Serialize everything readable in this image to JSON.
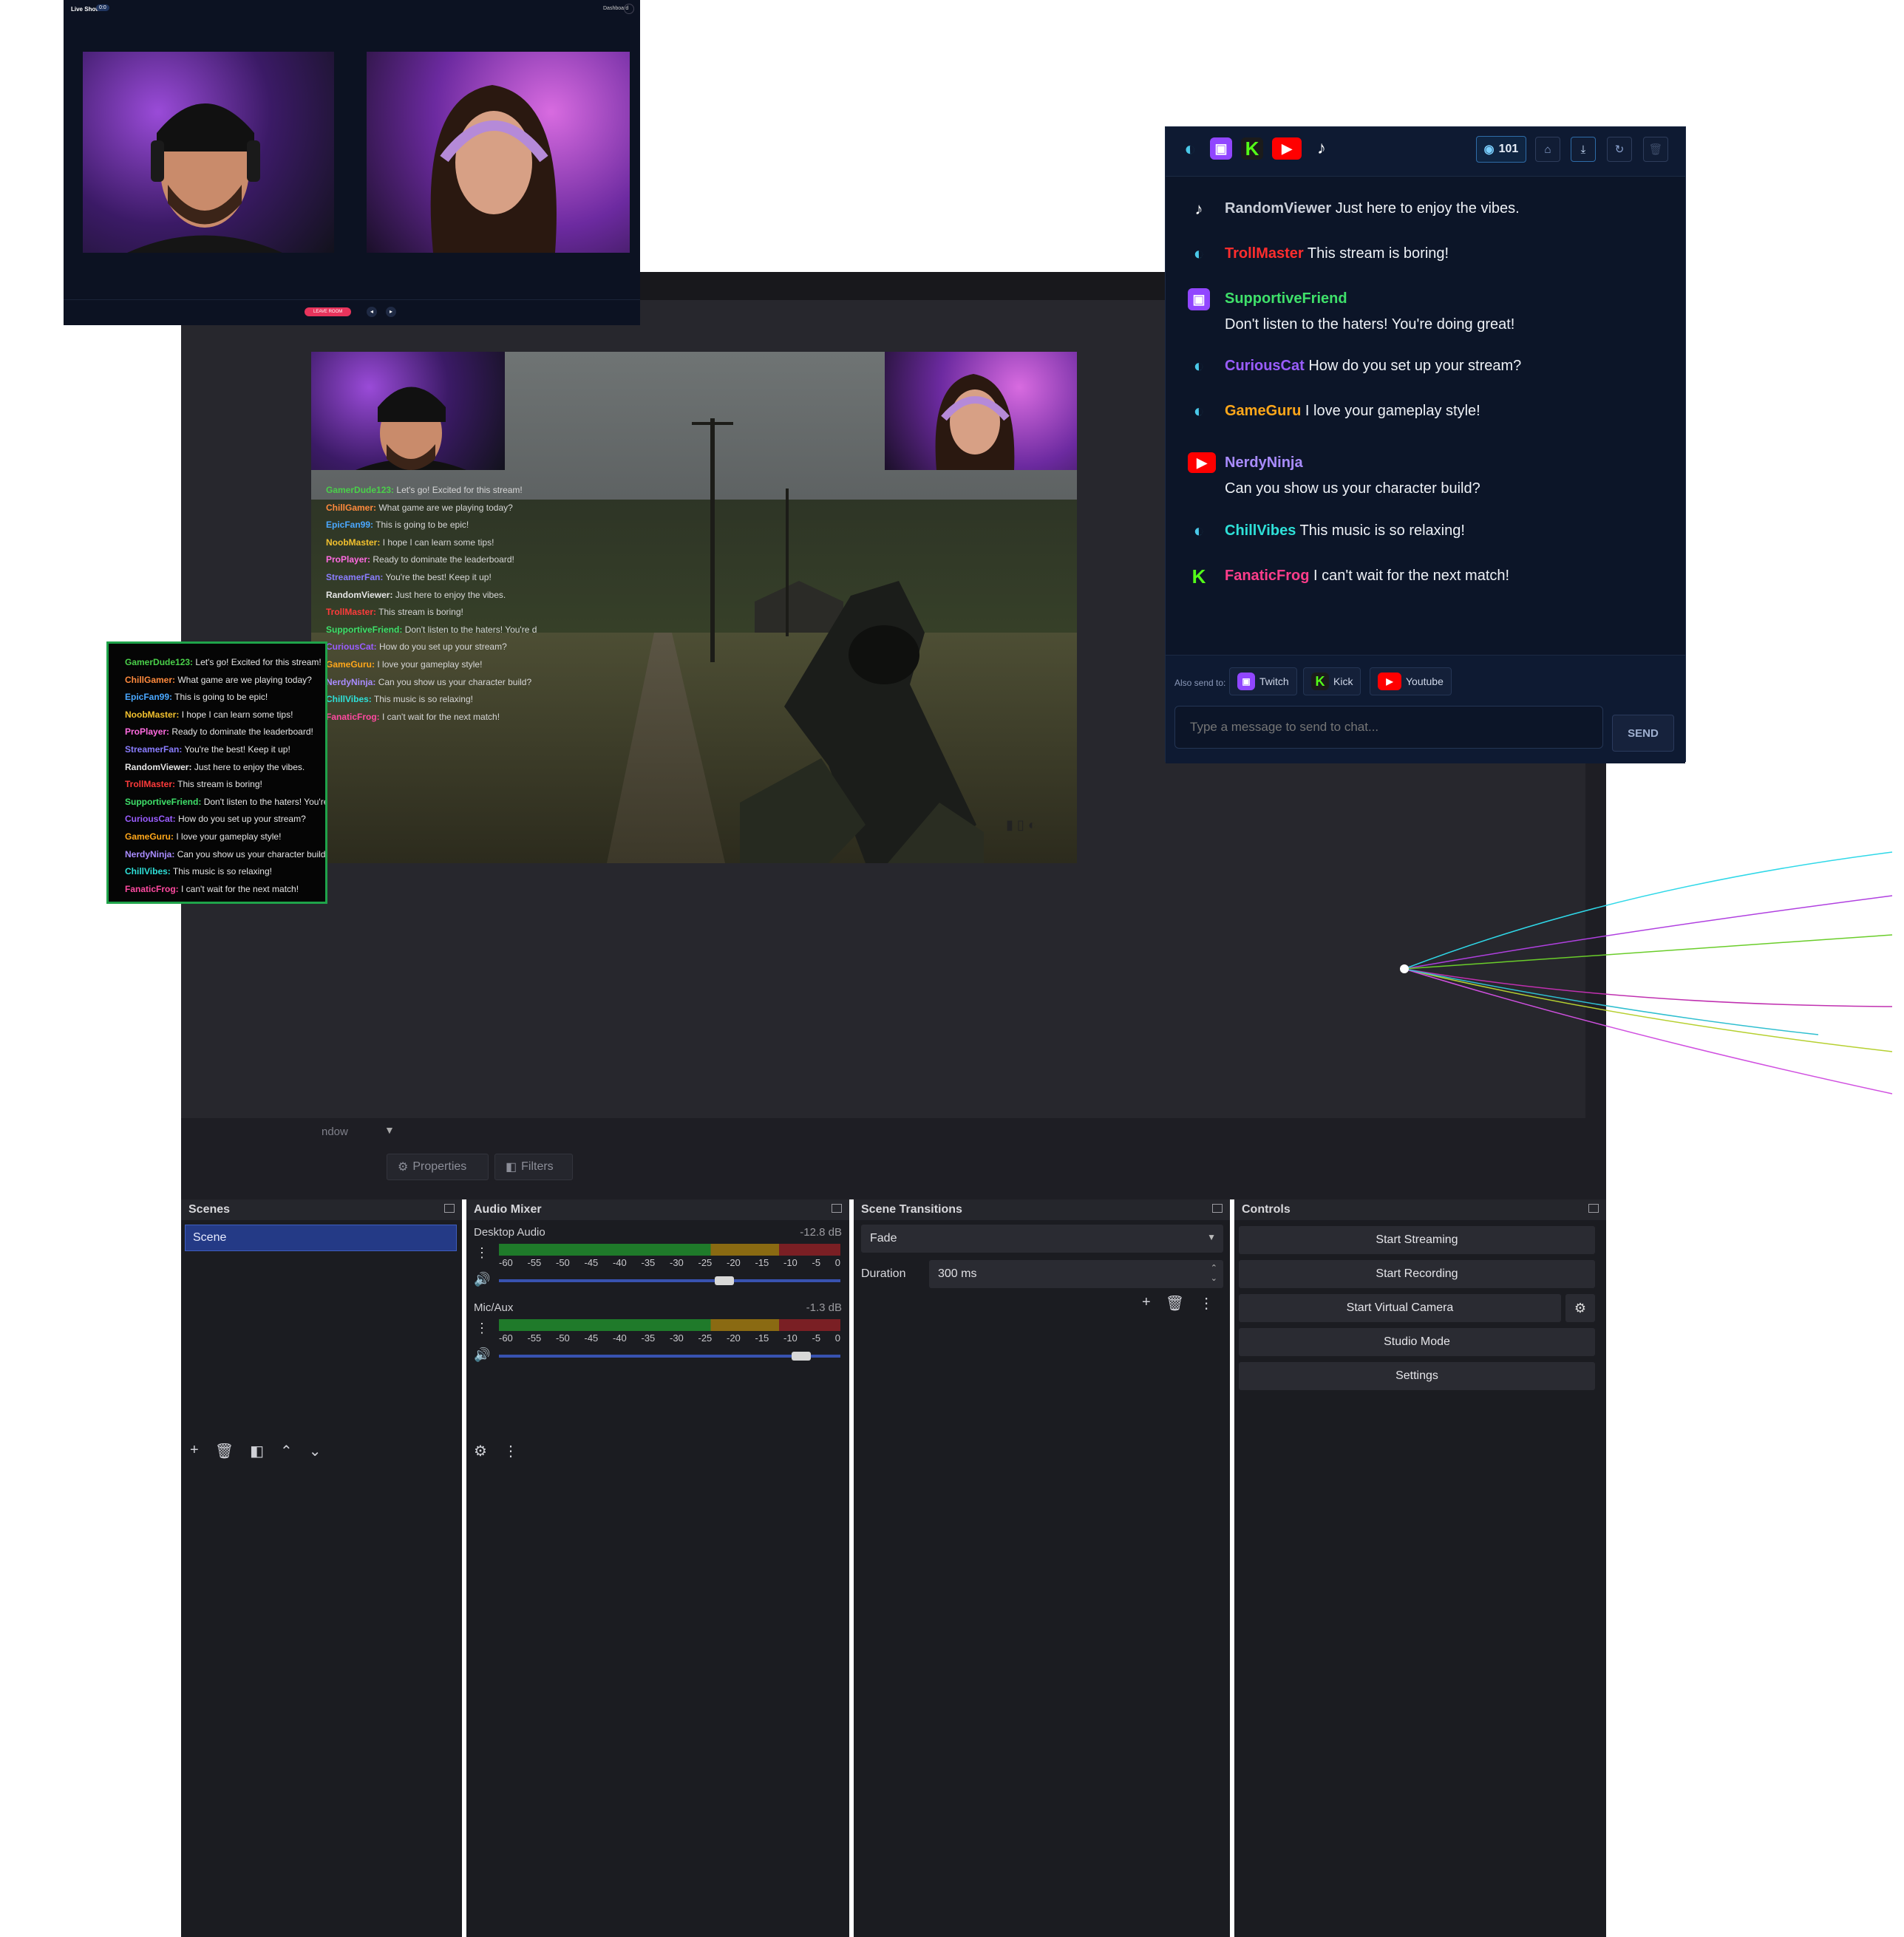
{
  "liveshow": {
    "title": "Live Show",
    "badge": "0:0",
    "right_label": "Dashboard",
    "leave_button": "LEAVE ROOM"
  },
  "obs": {
    "scene_dropdown_label": "ndow",
    "properties_label": "Properties",
    "filters_label": "Filters",
    "scenes": {
      "title": "Scenes",
      "items": [
        "Scene"
      ]
    },
    "audio_mixer": {
      "title": "Audio Mixer",
      "channels": [
        {
          "name": "Desktop Audio",
          "db": "-12.8 dB",
          "level": 0.68
        },
        {
          "name": "Mic/Aux",
          "db": "-1.3 dB",
          "level": 0.92
        }
      ],
      "scale": [
        "-60",
        "-55",
        "-50",
        "-45",
        "-40",
        "-35",
        "-30",
        "-25",
        "-20",
        "-15",
        "-10",
        "-5",
        "0"
      ]
    },
    "transitions": {
      "title": "Scene Transitions",
      "type": "Fade",
      "duration_label": "Duration",
      "duration_value": "300 ms"
    },
    "controls": {
      "title": "Controls",
      "buttons": [
        "Start Streaming",
        "Start Recording",
        "Start Virtual Camera",
        "Studio Mode",
        "Settings"
      ]
    }
  },
  "overlay_chat": [
    {
      "user": "GamerDude123:",
      "text": "Let's go! Excited for this stream!",
      "color": "#4ad04a"
    },
    {
      "user": "ChillGamer:",
      "text": "What game are we playing today?",
      "color": "#ff8a3d"
    },
    {
      "user": "EpicFan99:",
      "text": "This is going to be epic!",
      "color": "#4aa8ff"
    },
    {
      "user": "NoobMaster:",
      "text": "I hope I can learn some tips!",
      "color": "#f2c12e"
    },
    {
      "user": "ProPlayer:",
      "text": "Ready to dominate the leaderboard!",
      "color": "#ff6be0"
    },
    {
      "user": "StreamerFan:",
      "text": "You're the best! Keep it up!",
      "color": "#8a7dff"
    },
    {
      "user": "RandomViewer:",
      "text": "Just here to enjoy the vibes.",
      "color": "#e6e6e6"
    },
    {
      "user": "TrollMaster:",
      "text": "This stream is boring!",
      "color": "#ff3b3b"
    },
    {
      "user": "SupportiveFriend:",
      "text": "Don't listen to the haters! You're d",
      "color": "#3fe06a"
    },
    {
      "user": "CuriousCat:",
      "text": "How do you set up your stream?",
      "color": "#9a5dff"
    },
    {
      "user": "GameGuru:",
      "text": "I love your gameplay style!",
      "color": "#ffa71a"
    },
    {
      "user": "NerdyNinja:",
      "text": "Can you show us your character build?",
      "color": "#a98cff"
    },
    {
      "user": "ChillVibes:",
      "text": "This music is so relaxing!",
      "color": "#2ee0d8"
    },
    {
      "user": "FanaticFrog:",
      "text": "I can't wait for the next match!",
      "color": "#ff4aa0"
    }
  ],
  "chat_panel": {
    "viewer_count": "101",
    "messages": [
      {
        "platform": "tiktok",
        "user": "RandomViewer",
        "text": "Just here to enjoy the vibes.",
        "color": "#c9ced8"
      },
      {
        "platform": "globe",
        "user": "TrollMaster",
        "text": "This stream is boring!",
        "color": "#ff2d2d"
      },
      {
        "platform": "twitch",
        "user": "SupportiveFriend",
        "text": "Don't listen to the haters! You're doing great!",
        "color": "#3fe06a"
      },
      {
        "platform": "globe",
        "user": "CuriousCat",
        "text": "How do you set up your stream?",
        "color": "#9a5dff"
      },
      {
        "platform": "globe",
        "user": "GameGuru",
        "text": "I love your gameplay style!",
        "color": "#ffa71a"
      },
      {
        "platform": "youtube",
        "user": "NerdyNinja",
        "text": "Can you show us your character build?",
        "color": "#a98cff"
      },
      {
        "platform": "globe",
        "user": "ChillVibes",
        "text": "This music is so relaxing!",
        "color": "#2ee0d8"
      },
      {
        "platform": "kick",
        "user": "FanaticFrog",
        "text": "I can't wait for the next match!",
        "color": "#ff3d8a"
      }
    ],
    "also_send_label": "Also send to:",
    "targets": [
      "Twitch",
      "Kick",
      "Youtube"
    ],
    "input_placeholder": "Type a message to send to chat...",
    "send_label": "SEND"
  },
  "colors": {
    "twitch": "#9146ff",
    "kick": "#53fc18",
    "youtube": "#ff0000",
    "obs_select": "#243a86",
    "green_border": "#1fa34a"
  }
}
